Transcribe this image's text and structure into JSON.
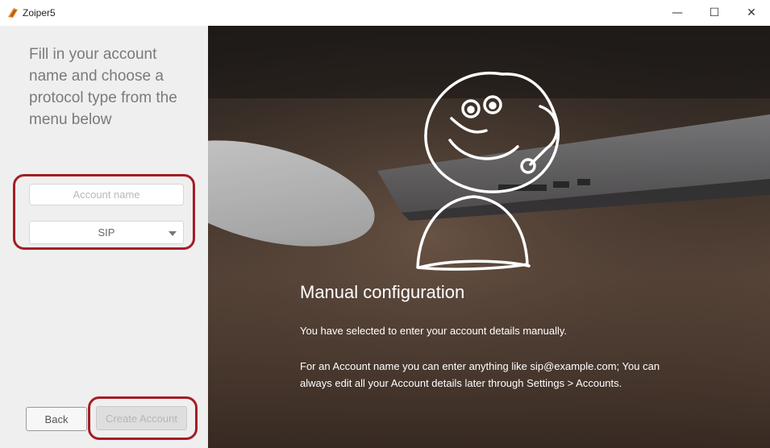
{
  "window": {
    "title": "Zoiper5",
    "controls": {
      "minimize": "—",
      "maximize": "☐",
      "close": "✕"
    }
  },
  "sidebar": {
    "instruction": "Fill in your account name and choose a protocol type from the menu below",
    "account_field": {
      "placeholder": "Account name",
      "value": ""
    },
    "protocol_select": {
      "value": "SIP"
    },
    "back_label": "Back",
    "create_label": "Create Account"
  },
  "hero": {
    "title": "Manual configuration",
    "text1": "You have selected to enter your account details manually.",
    "text2": "For an Account name you can enter anything like sip@example.com; You can always edit all your Account details later through Settings > Accounts."
  },
  "colors": {
    "highlight": "#a51d24",
    "sidebar_bg": "#efefef",
    "hero_text": "#ffffff"
  }
}
